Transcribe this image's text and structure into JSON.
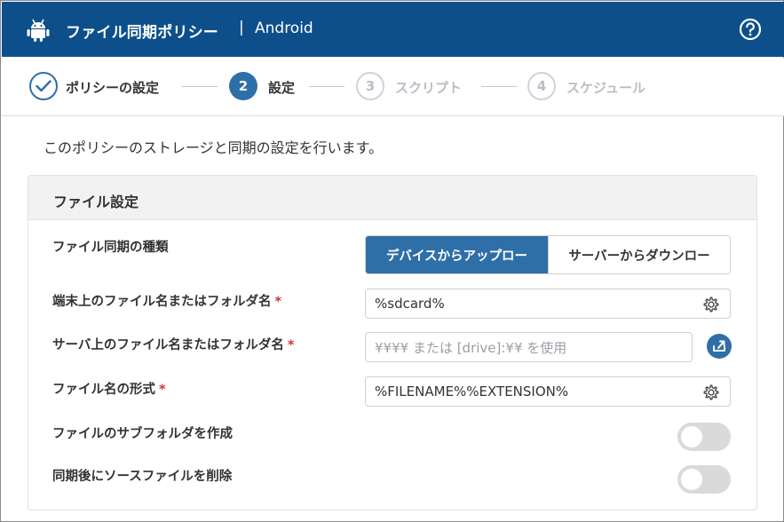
{
  "header": {
    "title": "ファイル同期ポリシー",
    "separator": "|",
    "platform": "Android"
  },
  "stepper": {
    "steps": [
      {
        "number": "",
        "label": "ポリシーの設定",
        "state": "done"
      },
      {
        "number": "2",
        "label": "設定",
        "state": "active"
      },
      {
        "number": "3",
        "label": "スクリプト",
        "state": "future"
      },
      {
        "number": "4",
        "label": "スケジュール",
        "state": "future"
      }
    ]
  },
  "intro": "このポリシーのストレージと同期の設定を行います。",
  "panel": {
    "title": "ファイル設定",
    "sync_type": {
      "label": "ファイル同期の種類",
      "options": [
        "デバイスからアップロー",
        "サーバーからダウンロー"
      ],
      "selected": "デバイスからアップロー"
    },
    "device_path": {
      "label": "端末上のファイル名またはフォルダ名",
      "required_mark": "*",
      "value": "%sdcard%"
    },
    "server_path": {
      "label": "サーバ上のファイル名またはフォルダ名",
      "required_mark": "*",
      "placeholder": "¥¥¥¥ または [drive]:¥¥ を使用"
    },
    "filename_format": {
      "label": "ファイル名の形式",
      "required_mark": "*",
      "value": "%FILENAME%%EXTENSION%"
    },
    "create_subfolder": {
      "label": "ファイルのサブフォルダを作成",
      "enabled": false
    },
    "delete_source": {
      "label": "同期後にソースファイルを削除",
      "enabled": false
    }
  },
  "colors": {
    "header_bg": "#0d4f8b",
    "accent": "#2f6fa8",
    "required": "#d0342c",
    "toggle_off": "#dadada"
  }
}
